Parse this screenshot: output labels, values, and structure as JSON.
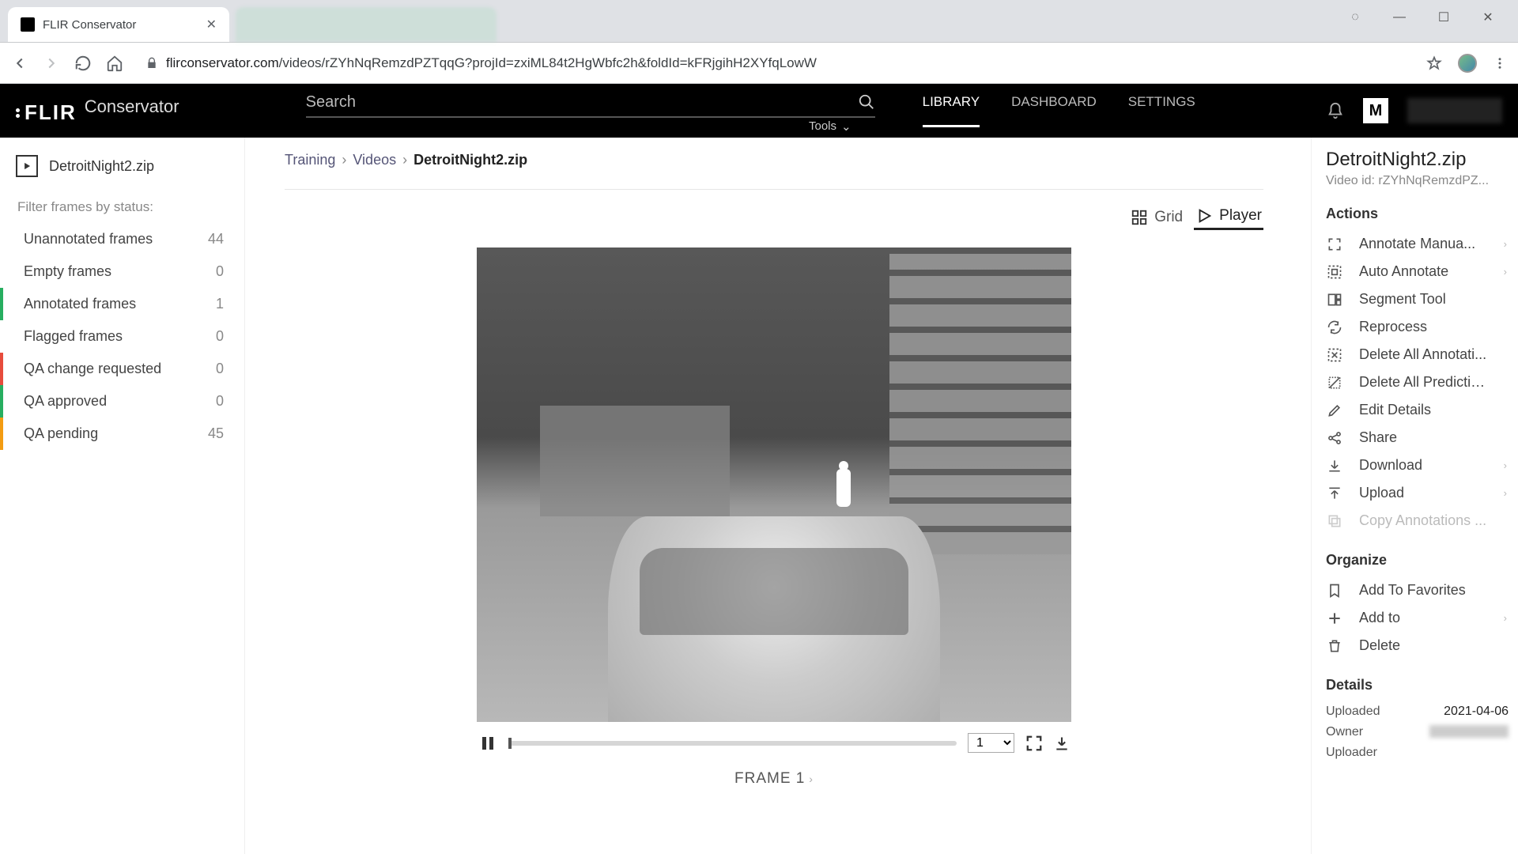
{
  "browser": {
    "tab_title": "FLIR Conservator",
    "url_host": "flirconservator.com",
    "url_path": "/videos/rZYhNqRemzdPZTqqG?projId=zxiML84t2HgWbfc2h&foldId=kFRjgihH2XYfqLowW"
  },
  "header": {
    "logo_main": "FLIR",
    "logo_sub": "Conservator",
    "search_placeholder": "Search",
    "tools_label": "Tools",
    "nav": [
      "LIBRARY",
      "DASHBOARD",
      "SETTINGS"
    ],
    "active_nav": "LIBRARY",
    "user_initial": "M"
  },
  "left": {
    "file_name": "DetroitNight2.zip",
    "filter_label": "Filter frames by status:",
    "statuses": [
      {
        "label": "Unannotated frames",
        "count": 44,
        "accent": ""
      },
      {
        "label": "Empty frames",
        "count": 0,
        "accent": ""
      },
      {
        "label": "Annotated frames",
        "count": 1,
        "accent": "green"
      },
      {
        "label": "Flagged frames",
        "count": 0,
        "accent": ""
      },
      {
        "label": "QA change requested",
        "count": 0,
        "accent": "red"
      },
      {
        "label": "QA approved",
        "count": 0,
        "accent": "green"
      },
      {
        "label": "QA pending",
        "count": 45,
        "accent": "orange"
      }
    ]
  },
  "center": {
    "breadcrumb": [
      "Training",
      "Videos",
      "DetroitNight2.zip"
    ],
    "view_grid": "Grid",
    "view_player": "Player",
    "active_view": "Player",
    "speed_value": "1",
    "frame_label": "FRAME 1"
  },
  "right": {
    "title": "DetroitNight2.zip",
    "video_id_label": "Video id: rZYhNqRemzdPZ...",
    "actions_header": "Actions",
    "actions": [
      {
        "label": "Annotate Manua...",
        "icon": "expand",
        "chev": true
      },
      {
        "label": "Auto Annotate",
        "icon": "boxselect",
        "chev": true
      },
      {
        "label": "Segment Tool",
        "icon": "segment",
        "chev": false
      },
      {
        "label": "Reprocess",
        "icon": "refresh",
        "chev": false
      },
      {
        "label": "Delete All Annotati...",
        "icon": "eraser",
        "chev": false
      },
      {
        "label": "Delete All Predictio...",
        "icon": "eraser2",
        "chev": false
      },
      {
        "label": "Edit Details",
        "icon": "pencil",
        "chev": false
      },
      {
        "label": "Share",
        "icon": "share",
        "chev": false
      },
      {
        "label": "Download",
        "icon": "download",
        "chev": true
      },
      {
        "label": "Upload",
        "icon": "upload",
        "chev": true
      },
      {
        "label": "Copy Annotations ...",
        "icon": "copy",
        "chev": false,
        "disabled": true
      }
    ],
    "organize_header": "Organize",
    "organize": [
      {
        "label": "Add To Favorites",
        "icon": "bookmark",
        "chev": false
      },
      {
        "label": "Add to",
        "icon": "plus",
        "chev": true
      },
      {
        "label": "Delete",
        "icon": "trash",
        "chev": false
      }
    ],
    "details_header": "Details",
    "details": {
      "uploaded_label": "Uploaded",
      "uploaded_value": "2021-04-06",
      "owner_label": "Owner",
      "uploader_label": "Uploader"
    }
  }
}
